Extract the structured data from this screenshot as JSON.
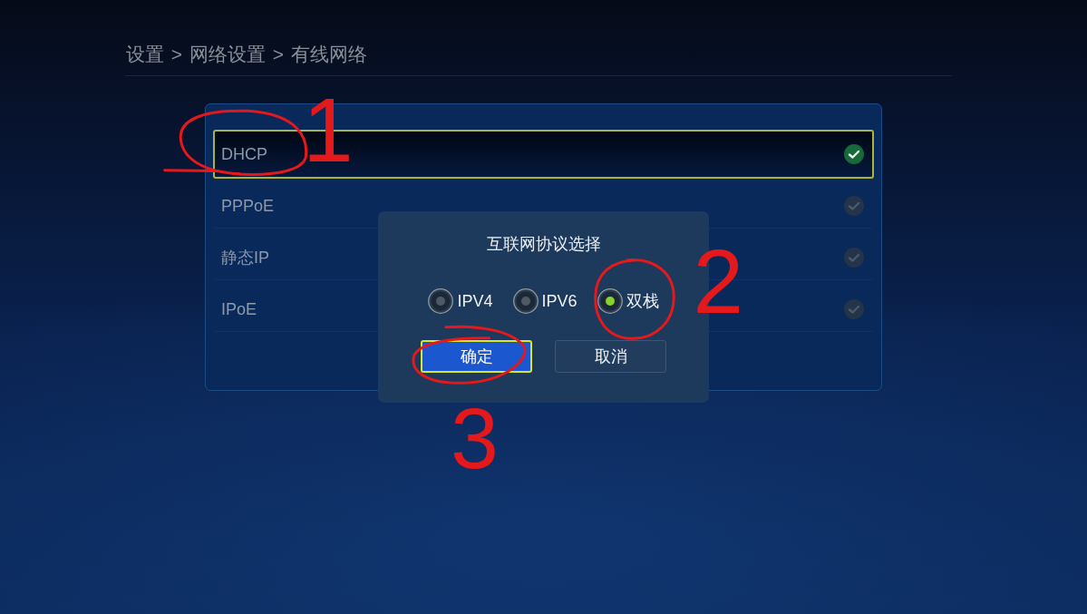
{
  "breadcrumb": "设置 > 网络设置 > 有线网络",
  "connection_types": [
    {
      "label": "DHCP",
      "selected": true,
      "focused": true,
      "annotation": "1"
    },
    {
      "label": "PPPoE",
      "selected": false,
      "focused": false
    },
    {
      "label": "静态IP",
      "selected": false,
      "focused": false
    },
    {
      "label": "IPoE",
      "selected": false,
      "focused": false
    }
  ],
  "dialog": {
    "title": "互联网协议选择",
    "options": [
      {
        "label": "IPV4",
        "selected": false
      },
      {
        "label": "IPV6",
        "selected": false
      },
      {
        "label": "双栈",
        "selected": true,
        "annotation": "2"
      }
    ],
    "buttons": [
      {
        "label": "确定",
        "kind": "primary",
        "focused": true,
        "annotation": "3"
      },
      {
        "label": "取消",
        "kind": "secondary",
        "focused": false
      }
    ]
  }
}
